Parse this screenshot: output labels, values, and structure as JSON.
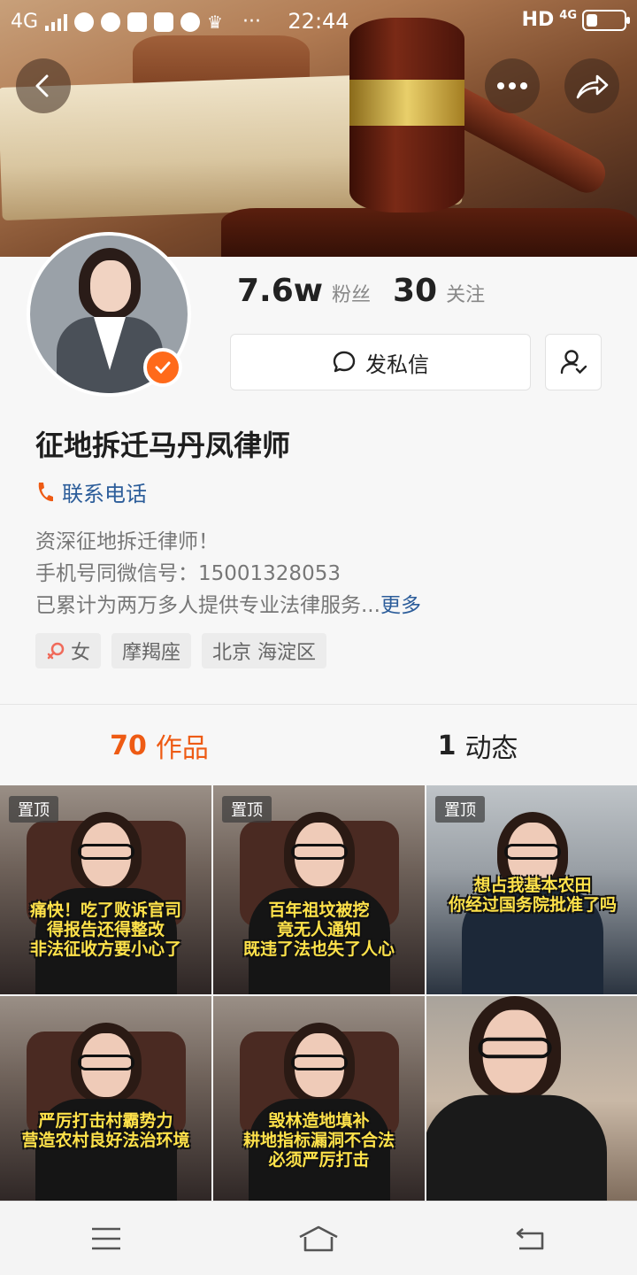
{
  "status_bar": {
    "network": "4G",
    "time": "22:44",
    "hd": "HD",
    "network_right": "4G",
    "battery_level": 0.3
  },
  "header": {
    "back_icon": "chevron-left-icon",
    "more_icon": "more-dots-icon",
    "share_icon": "share-arrow-icon"
  },
  "profile": {
    "fans_count": "7.6w",
    "fans_label": "粉丝",
    "following_count": "30",
    "following_label": "关注",
    "message_label": "发私信",
    "name": "征地拆迁马丹凤律师",
    "phone_label": "联系电话",
    "bio_lines": [
      "资深征地拆迁律师！",
      "手机号同微信号：15001328053",
      "已累计为两万多人提供专业法律服务..."
    ],
    "more_label": "更多",
    "tags": [
      "女",
      "摩羯座",
      "北京 海淀区"
    ],
    "colors": {
      "accent": "#ee5b14",
      "link": "#2c5d9a",
      "verified": "#ff6a1a"
    }
  },
  "tabs": [
    {
      "count": "70",
      "label": "作品",
      "active": true
    },
    {
      "count": "1",
      "label": "动态",
      "active": false
    }
  ],
  "videos": [
    {
      "pinned": true,
      "pin_label": "置顶",
      "caption": [
        "痛快！吃了败诉官司",
        "得报告还得整改",
        "非法征收方要小心了"
      ]
    },
    {
      "pinned": true,
      "pin_label": "置顶",
      "caption": [
        "百年祖坟被挖",
        "竟无人通知",
        "既违了法也失了人心"
      ]
    },
    {
      "pinned": true,
      "pin_label": "置顶",
      "caption": [
        "想占我基本农田",
        "你经过国务院批准了吗"
      ]
    },
    {
      "pinned": false,
      "caption": [
        "严厉打击村霸势力",
        "营造农村良好法治环境"
      ]
    },
    {
      "pinned": false,
      "caption": [
        "毁林造地填补",
        "耕地指标漏洞不合法",
        "必须严厉打击"
      ]
    },
    {
      "pinned": false,
      "caption": []
    }
  ],
  "nav": {
    "menu_icon": "menu-icon",
    "home_icon": "home-icon",
    "back_icon": "back-icon"
  }
}
